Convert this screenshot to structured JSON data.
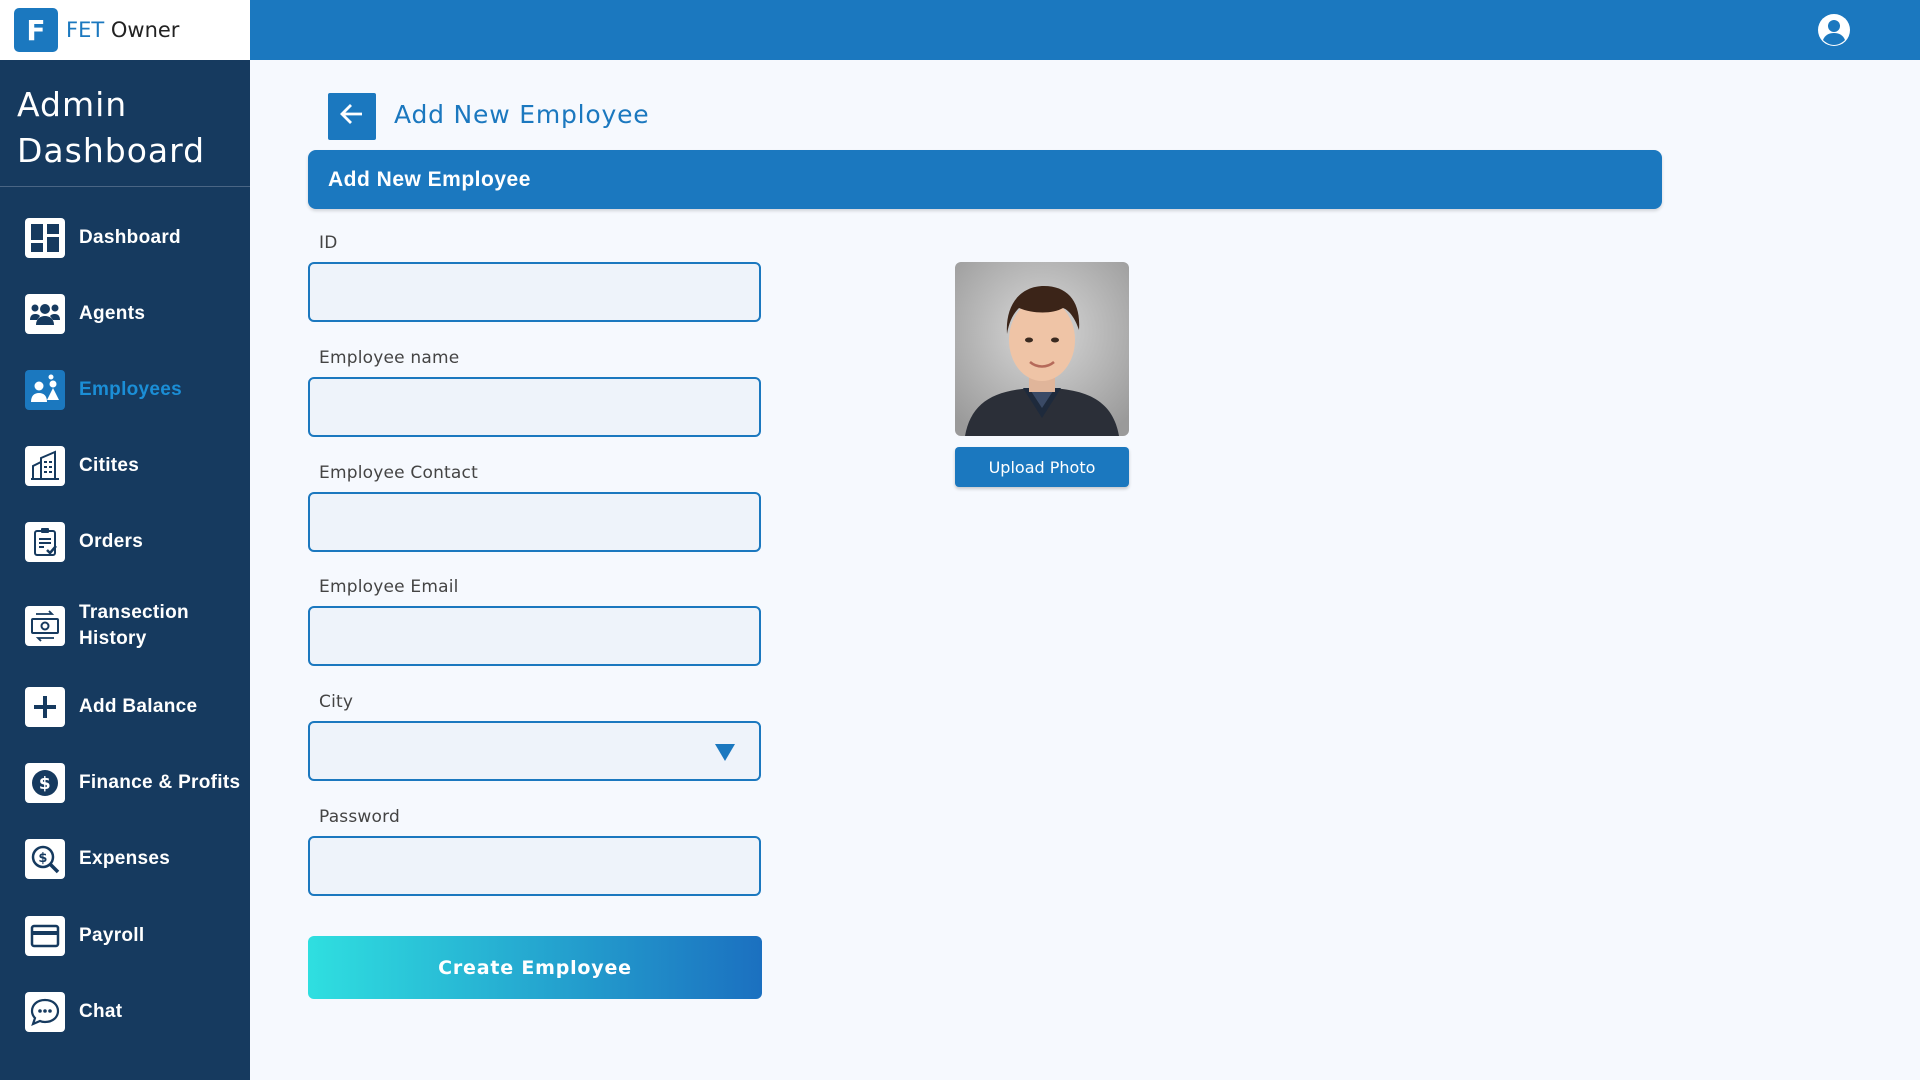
{
  "brand": {
    "logo_letter": "F",
    "prefix": "FET",
    "suffix": " Owner"
  },
  "sidebar": {
    "title_line1": "Admin",
    "title_line2": "Dashboard",
    "items": [
      {
        "label": "Dashboard",
        "icon": "dashboard-icon",
        "active": false
      },
      {
        "label": "Agents",
        "icon": "agents-icon",
        "active": false
      },
      {
        "label": "Employees",
        "icon": "employees-icon",
        "active": true
      },
      {
        "label": "Citites",
        "icon": "cities-icon",
        "active": false
      },
      {
        "label": "Orders",
        "icon": "orders-icon",
        "active": false
      },
      {
        "label": "Transection",
        "label2": "History",
        "icon": "transaction-history-icon",
        "active": false
      },
      {
        "label": "Add Balance",
        "icon": "add-balance-icon",
        "active": false
      },
      {
        "label": "Finance & Profits",
        "icon": "finance-icon",
        "active": false
      },
      {
        "label": "Expenses",
        "icon": "expenses-icon",
        "active": false
      },
      {
        "label": "Payroll",
        "icon": "payroll-icon",
        "active": false
      },
      {
        "label": "Chat",
        "icon": "chat-icon",
        "active": false
      }
    ]
  },
  "header": {
    "user_icon": "user-account-icon"
  },
  "page": {
    "title": "Add New Employee",
    "card_title": "Add New Employee"
  },
  "form": {
    "id_label": "ID",
    "id_value": "",
    "name_label": "Employee name",
    "name_value": "",
    "contact_label": "Employee Contact",
    "contact_value": "",
    "email_label": "Employee Email",
    "email_value": "",
    "city_label": "City",
    "city_value": "",
    "password_label": "Password",
    "password_value": "",
    "submit_label": "Create Employee"
  },
  "photo": {
    "upload_label": "Upload Photo"
  },
  "colors": {
    "primary": "#1b78bf",
    "sidebar": "#163a5f",
    "active": "#1b8ed6"
  }
}
